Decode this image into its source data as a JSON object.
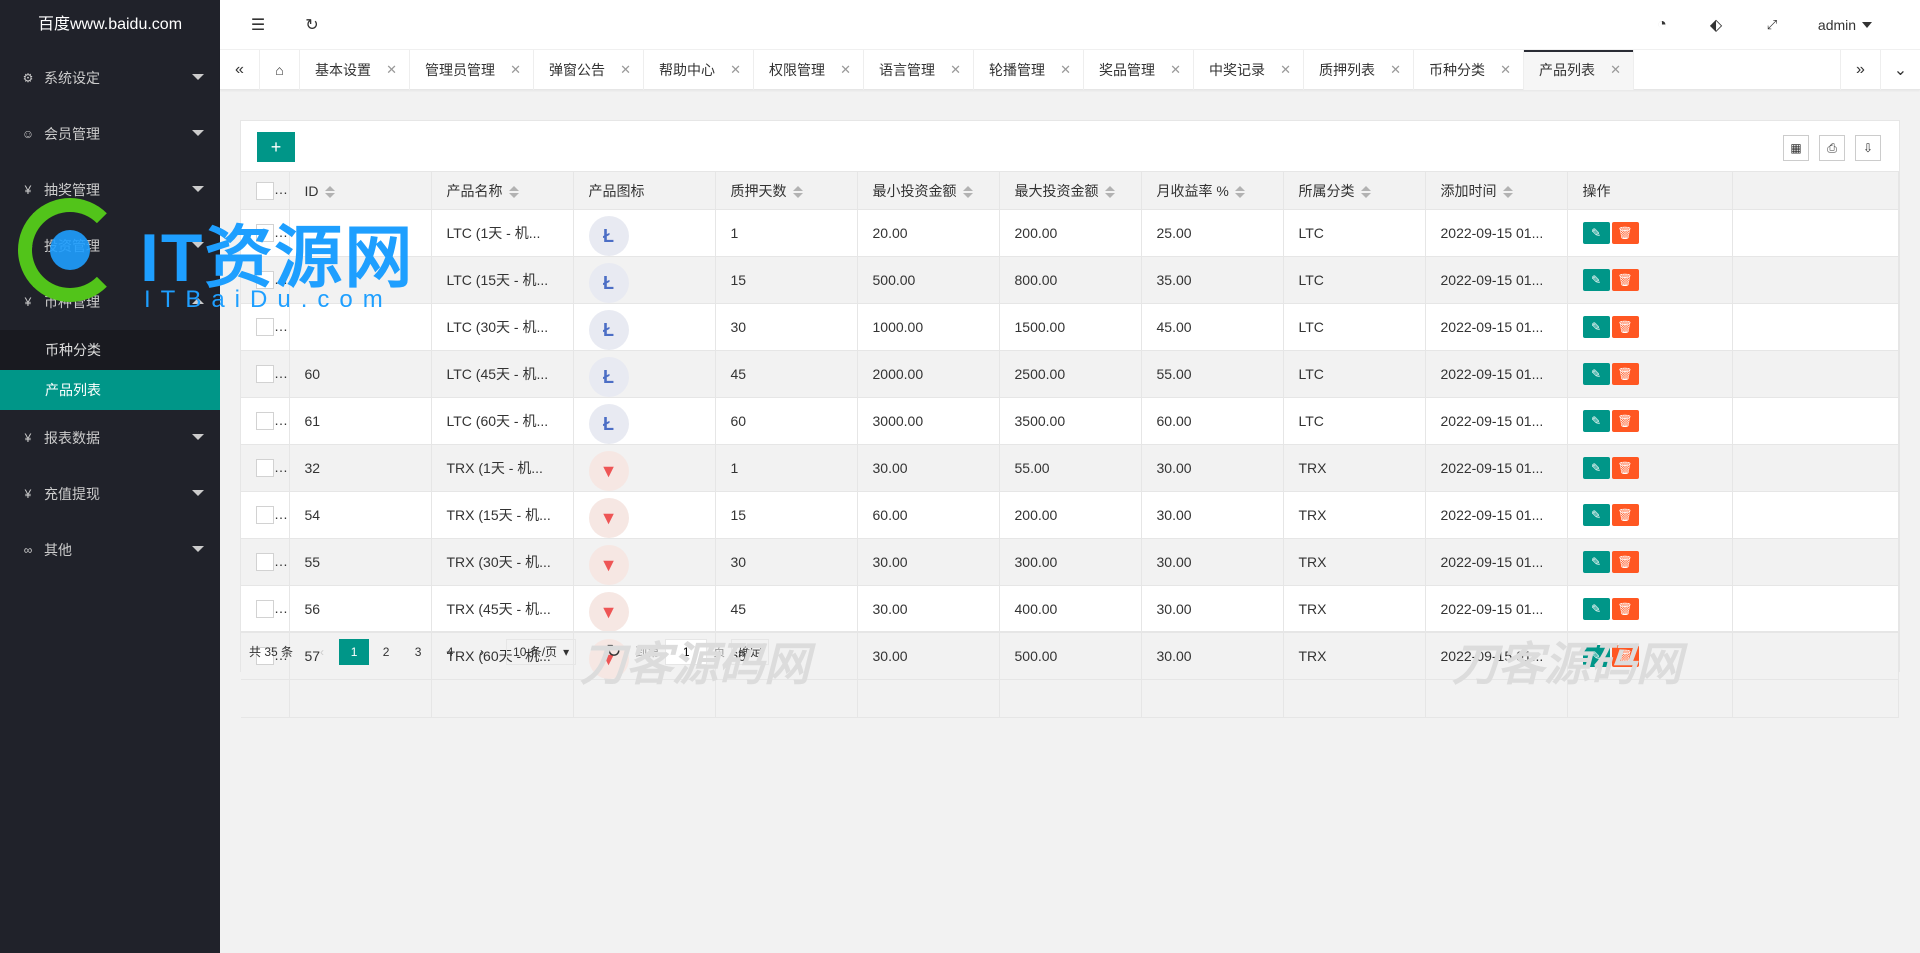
{
  "sidebar": {
    "logo": "百度www.baidu.com",
    "menu": [
      {
        "label": "系统设定",
        "icon": "gear-icon"
      },
      {
        "label": "会员管理",
        "icon": "user-icon"
      },
      {
        "label": "抽奖管理",
        "icon": "yen-icon"
      },
      {
        "label": "投资管理",
        "icon": "gear-icon"
      },
      {
        "label": "币种管理",
        "icon": "yen-icon"
      },
      {
        "label": "报表数据",
        "icon": "yen-icon"
      },
      {
        "label": "充值提现",
        "icon": "yen-icon"
      },
      {
        "label": "其他",
        "icon": "link-icon"
      }
    ],
    "sub": [
      "币种分类",
      "产品列表"
    ]
  },
  "header": {
    "user": "admin"
  },
  "tabs": [
    "基本设置",
    "管理员管理",
    "弹窗公告",
    "帮助中心",
    "权限管理",
    "语言管理",
    "轮播管理",
    "奖品管理",
    "中奖记录",
    "质押列表",
    "币种分类",
    "产品列表"
  ],
  "table": {
    "columns": [
      "ID",
      "产品名称",
      "产品图标",
      "质押天数",
      "最小投资金额",
      "最大投资金额",
      "月收益率 %",
      "所属分类",
      "添加时间",
      "操作"
    ],
    "rows": [
      {
        "id": "",
        "name": "LTC (1天 - 机...",
        "coin": "ltc",
        "days": "1",
        "min": "20.00",
        "max": "200.00",
        "rate": "25.00",
        "cat": "LTC",
        "time": "2022-09-15 01..."
      },
      {
        "id": "",
        "name": "LTC (15天 - 机...",
        "coin": "ltc",
        "days": "15",
        "min": "500.00",
        "max": "800.00",
        "rate": "35.00",
        "cat": "LTC",
        "time": "2022-09-15 01..."
      },
      {
        "id": "",
        "name": "LTC (30天 - 机...",
        "coin": "ltc",
        "days": "30",
        "min": "1000.00",
        "max": "1500.00",
        "rate": "45.00",
        "cat": "LTC",
        "time": "2022-09-15 01..."
      },
      {
        "id": "60",
        "name": "LTC (45天 - 机...",
        "coin": "ltc",
        "days": "45",
        "min": "2000.00",
        "max": "2500.00",
        "rate": "55.00",
        "cat": "LTC",
        "time": "2022-09-15 01..."
      },
      {
        "id": "61",
        "name": "LTC (60天 - 机...",
        "coin": "ltc",
        "days": "60",
        "min": "3000.00",
        "max": "3500.00",
        "rate": "60.00",
        "cat": "LTC",
        "time": "2022-09-15 01..."
      },
      {
        "id": "32",
        "name": "TRX (1天 - 机...",
        "coin": "trx",
        "days": "1",
        "min": "30.00",
        "max": "55.00",
        "rate": "30.00",
        "cat": "TRX",
        "time": "2022-09-15 01..."
      },
      {
        "id": "54",
        "name": "TRX (15天 - 机...",
        "coin": "trx",
        "days": "15",
        "min": "60.00",
        "max": "200.00",
        "rate": "30.00",
        "cat": "TRX",
        "time": "2022-09-15 01..."
      },
      {
        "id": "55",
        "name": "TRX (30天 - 机...",
        "coin": "trx",
        "days": "30",
        "min": "30.00",
        "max": "300.00",
        "rate": "30.00",
        "cat": "TRX",
        "time": "2022-09-15 01..."
      },
      {
        "id": "56",
        "name": "TRX (45天 - 机...",
        "coin": "trx",
        "days": "45",
        "min": "30.00",
        "max": "400.00",
        "rate": "30.00",
        "cat": "TRX",
        "time": "2022-09-15 01..."
      },
      {
        "id": "57",
        "name": "TRX (60天 - 机...",
        "coin": "trx",
        "days": "60",
        "min": "30.00",
        "max": "500.00",
        "rate": "30.00",
        "cat": "TRX",
        "time": "2022-09-15 01..."
      }
    ]
  },
  "pager": {
    "total": "共 35 条",
    "pages": [
      "1",
      "2",
      "3",
      "4"
    ],
    "size": "10 条/页",
    "goto": "到第",
    "page_val": "1",
    "unit": "页",
    "ok": "确定"
  },
  "watermarks": {
    "it_main": "IT资源网",
    "it_sub": "ITBaiDu.com",
    "mark1": "刀客源码网",
    "mark2": "刀客源码网"
  },
  "colors": {
    "accent": "#009688",
    "danger": "#ff5722",
    "sidebar": "#20222a"
  }
}
